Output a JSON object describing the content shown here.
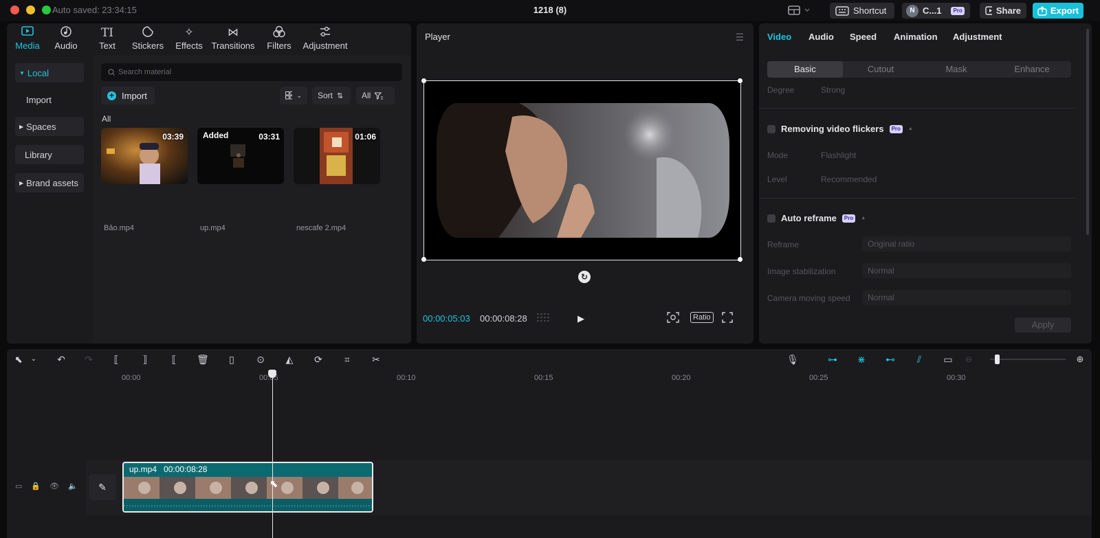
{
  "titlebar": {
    "autosave": "Auto saved: 23:34:15",
    "doc_title": "1218 (8)",
    "shortcut_label": "Shortcut",
    "user_initial": "N",
    "user_name": "C...1",
    "pro_label": "Pro",
    "share_label": "Share",
    "export_label": "Export"
  },
  "media_tools": [
    {
      "label": "Media",
      "icon": "media-icon"
    },
    {
      "label": "Audio",
      "icon": "audio-icon"
    },
    {
      "label": "Text",
      "icon": "text-icon"
    },
    {
      "label": "Stickers",
      "icon": "stickers-icon"
    },
    {
      "label": "Effects",
      "icon": "effects-icon"
    },
    {
      "label": "Transitions",
      "icon": "transitions-icon"
    },
    {
      "label": "Filters",
      "icon": "filters-icon"
    },
    {
      "label": "Adjustment",
      "icon": "adjustment-icon"
    }
  ],
  "media_side": {
    "local": "Local",
    "import": "Import",
    "spaces": "Spaces",
    "library": "Library",
    "brand_assets": "Brand assets"
  },
  "media_main": {
    "search_placeholder": "Search material",
    "import_label": "Import",
    "sort_label": "Sort",
    "all_filter": "All",
    "section_label": "All",
    "items": [
      {
        "name": "Bảo.mp4",
        "duration": "03:39",
        "added": ""
      },
      {
        "name": "up.mp4",
        "duration": "03:31",
        "added": "Added"
      },
      {
        "name": "nescafe 2.mp4",
        "duration": "01:06",
        "added": ""
      }
    ]
  },
  "player": {
    "title": "Player",
    "current_time": "00:00:05:03",
    "total_time": "00:00:08:28",
    "ratio_label": "Ratio"
  },
  "props": {
    "tabs": [
      "Video",
      "Audio",
      "Speed",
      "Animation",
      "Adjustment"
    ],
    "subtabs": [
      "Basic",
      "Cutout",
      "Mask",
      "Enhance"
    ],
    "degree_label": "Degree",
    "degree_value": "Strong",
    "flicker_label": "Removing video flickers",
    "mode_label": "Mode",
    "mode_value": "Flashlight",
    "level_label": "Level",
    "level_value": "Recommended",
    "reframe_section": "Auto reframe",
    "reframe_label": "Reframe",
    "reframe_value": "Original ratio",
    "stab_label": "Image stabilization",
    "stab_value": "Normal",
    "camera_label": "Camera moving speed",
    "camera_value": "Normal",
    "apply_label": "Apply",
    "pro_label": "Pro"
  },
  "timeline": {
    "ruler_labels": [
      "00:00",
      "00:05",
      "00:10",
      "00:15",
      "00:20",
      "00:25",
      "00:30"
    ],
    "clip_name": "up.mp4",
    "clip_duration": "00:00:08:28"
  },
  "colors": {
    "accent": "#22c4de",
    "export": "#19c0d8",
    "clip": "#0b6a70"
  }
}
